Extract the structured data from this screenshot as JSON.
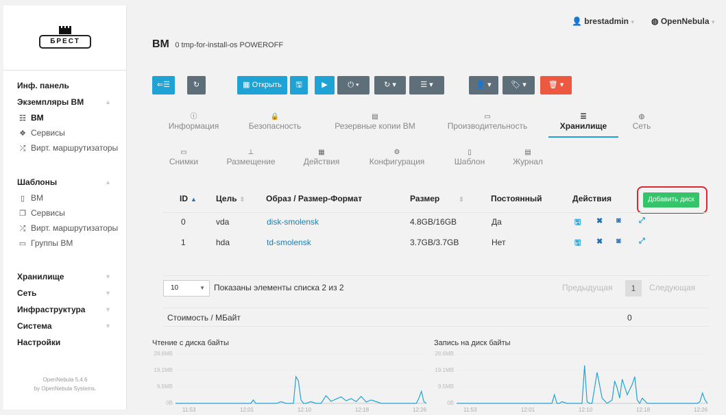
{
  "header": {
    "title": "ВМ",
    "vm_id": "0",
    "vm_name": "tmp-for-install-os",
    "vm_state": "POWEROFF",
    "user": "brestadmin",
    "zone": "OpenNebula"
  },
  "logo": {
    "text": "БРЕСТ"
  },
  "sidebar": {
    "dashboard": "Инф. панель",
    "instances": "Экземпляры ВМ",
    "instances_items": [
      "ВМ",
      "Сервисы",
      "Вирт. маршрутизаторы"
    ],
    "templates": "Шаблоны",
    "templates_items": [
      "ВМ",
      "Сервисы",
      "Вирт. маршрутизаторы",
      "Группы ВМ"
    ],
    "storage": "Хранилище",
    "network": "Сеть",
    "infrastructure": "Инфраструктура",
    "system": "Система",
    "settings": "Настройки",
    "footer_line1": "OpenNebula 5.4.6",
    "footer_line2": "by OpenNebula Systems."
  },
  "toolbar": {
    "open_label": "Открыть"
  },
  "tabs_row1": [
    {
      "icon": "info-icon",
      "label": "Информация"
    },
    {
      "icon": "lock-icon",
      "label": "Безопасность"
    },
    {
      "icon": "archive-icon",
      "label": "Резервные копии ВМ"
    },
    {
      "icon": "laptop-icon",
      "label": "Производительность"
    },
    {
      "icon": "server-icon",
      "label": "Хранилище"
    },
    {
      "icon": "globe-icon",
      "label": "Сеть"
    }
  ],
  "tabs_row2": [
    {
      "icon": "laptop-icon",
      "label": "Снимки"
    },
    {
      "icon": "sitemap-icon",
      "label": "Размещение"
    },
    {
      "icon": "calendar-icon",
      "label": "Действия"
    },
    {
      "icon": "cog-icon",
      "label": "Конфигурация"
    },
    {
      "icon": "file-icon",
      "label": "Шаблон"
    },
    {
      "icon": "file-text-icon",
      "label": "Журнал"
    }
  ],
  "disks_table": {
    "columns": [
      "ID",
      "Цель",
      "Образ / Размер-Формат",
      "Размер",
      "Постоянный",
      "Действия"
    ],
    "add_button": "Добавить диск",
    "rows": [
      {
        "id": "0",
        "target": "vda",
        "image": "disk-smolensk",
        "size": "4.8GB/16GB",
        "persistent": "Да"
      },
      {
        "id": "1",
        "target": "hda",
        "image": "td-smolensk",
        "size": "3.7GB/3.7GB",
        "persistent": "Нет"
      }
    ]
  },
  "pager": {
    "page_size": "10",
    "info": "Показаны элементы списка 2 из 2",
    "prev": "Предыдущая",
    "current": "1",
    "next": "Следующая"
  },
  "cost": {
    "label": "Стоимость / МБайт",
    "value": "0"
  },
  "chart_data": [
    {
      "type": "line",
      "title": "Чтение с диска байты",
      "y_ticks": [
        "28.6MB",
        "19.1MB",
        "9.5MB",
        "0B"
      ],
      "x_ticks": [
        "11:53",
        "12:01",
        "12:10",
        "12:18",
        "12:26"
      ],
      "ylim": [
        0,
        28.6
      ],
      "color": "#1fa3d5",
      "x": [
        0,
        2,
        4,
        6,
        8,
        10,
        12,
        14,
        16,
        18,
        20,
        22,
        24,
        26,
        28,
        30,
        31,
        32,
        33,
        34,
        35,
        36,
        38,
        40,
        41,
        42,
        43,
        44,
        45,
        46,
        47,
        48,
        49,
        50,
        51,
        52,
        54,
        56,
        58,
        60,
        62,
        64,
        66,
        68,
        70,
        72,
        74,
        76,
        78,
        80,
        82,
        84,
        86,
        88,
        90,
        92,
        94,
        96,
        97,
        98,
        99,
        100
      ],
      "series": [
        {
          "values": [
            0,
            0,
            0,
            0,
            0,
            0,
            0,
            0,
            0,
            0,
            0,
            0,
            0,
            0,
            0,
            0,
            2.0,
            0,
            0,
            0,
            0,
            0,
            0,
            0,
            0.3,
            1.0,
            0.5,
            0,
            0,
            0,
            0,
            15.5,
            13.0,
            2.0,
            0,
            0,
            1.0,
            0,
            0,
            4.5,
            1.2,
            2.5,
            3.8,
            1.5,
            2.8,
            1.0,
            4.0,
            0.8,
            2.0,
            1.0,
            0,
            0,
            0,
            0,
            0,
            0,
            0,
            0,
            3.0,
            7.0,
            1.0,
            0
          ]
        }
      ]
    },
    {
      "type": "line",
      "title": "Запись на диск байты",
      "y_ticks": [
        "28.6MB",
        "19.1MB",
        "9.5MB",
        "0B"
      ],
      "x_ticks": [
        "11:53",
        "12:01",
        "12:10",
        "12:18",
        "12:26"
      ],
      "ylim": [
        0,
        28.6
      ],
      "color": "#1fa3d5",
      "x": [
        0,
        2,
        4,
        6,
        8,
        10,
        12,
        14,
        16,
        18,
        20,
        22,
        24,
        26,
        28,
        30,
        32,
        34,
        36,
        38,
        39,
        40,
        41,
        42,
        44,
        46,
        48,
        50,
        51,
        52,
        53,
        54,
        56,
        58,
        60,
        62,
        63,
        64,
        65,
        66,
        68,
        70,
        71,
        72,
        73,
        74,
        76,
        78,
        80,
        82,
        84,
        86,
        88,
        90,
        92,
        94,
        96,
        97,
        98,
        99,
        100
      ],
      "series": [
        {
          "values": [
            0,
            0,
            0,
            0,
            0,
            0,
            0,
            0,
            0,
            0,
            0,
            0,
            0,
            0,
            0,
            0,
            0,
            0,
            0,
            0,
            5.0,
            0,
            0,
            1.0,
            0,
            0,
            0,
            0,
            22.0,
            1.0,
            0,
            0,
            18.0,
            3.0,
            0,
            2.0,
            13.0,
            9.0,
            3.0,
            14.0,
            5.0,
            11.0,
            15.5,
            2.0,
            0,
            3.0,
            0,
            0,
            0,
            0,
            0,
            0,
            0,
            0,
            0,
            0,
            0,
            1.0,
            6.0,
            2.0,
            0
          ]
        }
      ]
    }
  ]
}
